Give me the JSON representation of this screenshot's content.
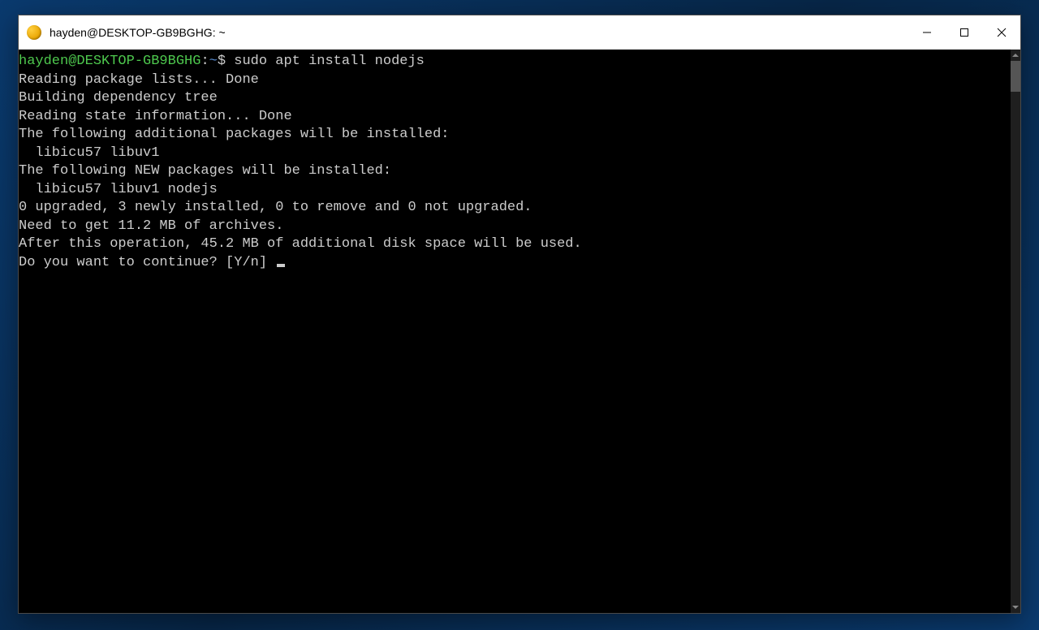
{
  "window": {
    "title": "hayden@DESKTOP-GB9BGHG: ~"
  },
  "prompt": {
    "user_host": "hayden@DESKTOP-GB9BGHG",
    "separator": ":",
    "path": "~",
    "symbol": "$",
    "command": "sudo apt install nodejs"
  },
  "output": {
    "line1": "Reading package lists... Done",
    "line2": "Building dependency tree",
    "line3": "Reading state information... Done",
    "line4": "The following additional packages will be installed:",
    "line5": "  libicu57 libuv1",
    "line6": "The following NEW packages will be installed:",
    "line7": "  libicu57 libuv1 nodejs",
    "line8": "0 upgraded, 3 newly installed, 0 to remove and 0 not upgraded.",
    "line9": "Need to get 11.2 MB of archives.",
    "line10": "After this operation, 45.2 MB of additional disk space will be used.",
    "line11": "Do you want to continue? [Y/n] "
  },
  "colors": {
    "prompt_user": "#4ec94e",
    "prompt_path": "#5a8fd6",
    "fg": "#cccccc",
    "bg": "#000000"
  }
}
